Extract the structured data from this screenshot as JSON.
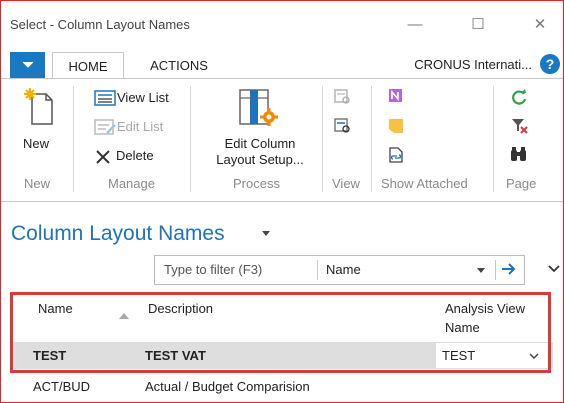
{
  "window": {
    "title": "Select - Column Layout Names",
    "minimize_glyph": "—",
    "maximize_glyph": "☐",
    "close_glyph": "✕"
  },
  "tabs": [
    {
      "label": "HOME",
      "active": true
    },
    {
      "label": "ACTIONS",
      "active": false
    }
  ],
  "company": "CRONUS Internati...",
  "help_label": "?",
  "ribbon": {
    "new": {
      "label": "New",
      "group": "New"
    },
    "manage": {
      "group": "Manage",
      "view_list": "View List",
      "edit_list": "Edit List",
      "delete": "Delete"
    },
    "process": {
      "group": "Process",
      "edit_column_line1": "Edit Column",
      "edit_column_line2": "Layout Setup..."
    },
    "view": {
      "group": "View"
    },
    "show_attached": {
      "group": "Show Attached"
    },
    "page": {
      "group": "Page"
    }
  },
  "page_title": "Column Layout Names",
  "filter": {
    "placeholder": "Type to filter (F3)",
    "field_value": "Name"
  },
  "table": {
    "columns": {
      "name": "Name",
      "description": "Description",
      "analysis_view_line1": "Analysis View",
      "analysis_view_line2": "Name"
    },
    "rows": [
      {
        "name": "TEST",
        "description": "TEST VAT",
        "analysis_view": "TEST",
        "selected": true
      },
      {
        "name": "ACT/BUD",
        "description": "Actual / Budget Comparision",
        "analysis_view": "",
        "selected": false
      }
    ]
  },
  "colors": {
    "accent": "#1979c3",
    "highlight_border": "#d83a35",
    "frame_border": "#e1262b",
    "selected_row": "#dedede"
  }
}
